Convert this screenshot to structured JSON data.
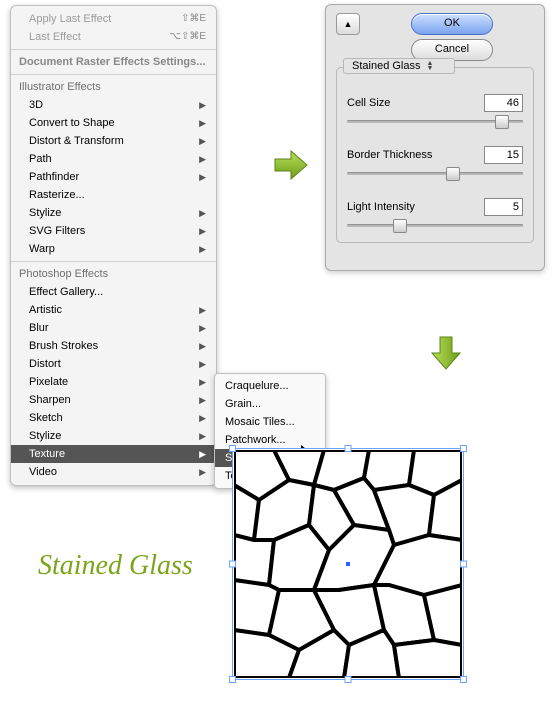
{
  "menu": {
    "apply_last": "Apply Last Effect",
    "apply_shortcut": "⇧⌘E",
    "last_effect": "Last Effect",
    "last_shortcut": "⌥⇧⌘E",
    "doc_raster": "Document Raster Effects Settings...",
    "illustrator_header": "Illustrator Effects",
    "photoshop_header": "Photoshop Effects",
    "items_ai": [
      "3D",
      "Convert to Shape",
      "Distort & Transform",
      "Path",
      "Pathfinder",
      "Rasterize...",
      "Stylize",
      "SVG Filters",
      "Warp"
    ],
    "items_ps": [
      "Effect Gallery...",
      "Artistic",
      "Blur",
      "Brush Strokes",
      "Distort",
      "Pixelate",
      "Sharpen",
      "Sketch",
      "Stylize",
      "Texture",
      "Video"
    ],
    "selected_top": "Texture",
    "submenu": [
      "Craquelure...",
      "Grain...",
      "Mosaic Tiles...",
      "Patchwork...",
      "Stained Glass...",
      "Texturizer..."
    ],
    "submenu_selected": "Stained Glass..."
  },
  "dialog": {
    "ok": "OK",
    "cancel": "Cancel",
    "group_title": "Stained Glass",
    "fields": [
      {
        "label": "Cell Size",
        "value": "46",
        "pos": 88
      },
      {
        "label": "Border Thickness",
        "value": "15",
        "pos": 60
      },
      {
        "label": "Light Intensity",
        "value": "5",
        "pos": 30
      }
    ]
  },
  "caption": "Stained Glass"
}
